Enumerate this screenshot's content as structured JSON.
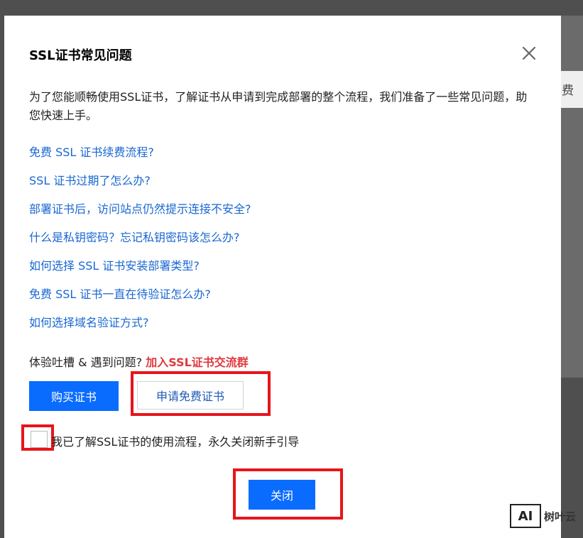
{
  "modal": {
    "title": "SSL证书常见问题",
    "intro": "为了您能顺畅使用SSL证书，了解证书从申请到完成部署的整个流程，我们准备了一些常见问题，助您快速上手。",
    "faq_links": [
      "免费 SSL 证书续费流程?",
      "SSL 证书过期了怎么办?",
      "部署证书后，访问站点仍然提示连接不安全?",
      "什么是私钥密码？忘记私钥密码该怎么办?",
      "如何选择 SSL 证书安装部署类型?",
      "免费 SSL 证书一直在待验证怎么办?",
      "如何选择域名验证方式?"
    ],
    "feedback_text": "体验吐槽 & 遇到问题?",
    "feedback_link": "加入SSL证书交流群",
    "buy_button": "购买证书",
    "apply_button": "申请免费证书",
    "checkbox_label": "我已了解SSL证书的使用流程，永久关闭新手引导",
    "close_button": "关闭"
  },
  "background": {
    "side_text_right": "费"
  },
  "watermark": {
    "logo_text": "AI",
    "text": "树叶云"
  },
  "colors": {
    "link": "#1967d2",
    "primary": "#0a6cff",
    "accent_red": "#e0393e",
    "highlight_box": "#e8141b"
  }
}
